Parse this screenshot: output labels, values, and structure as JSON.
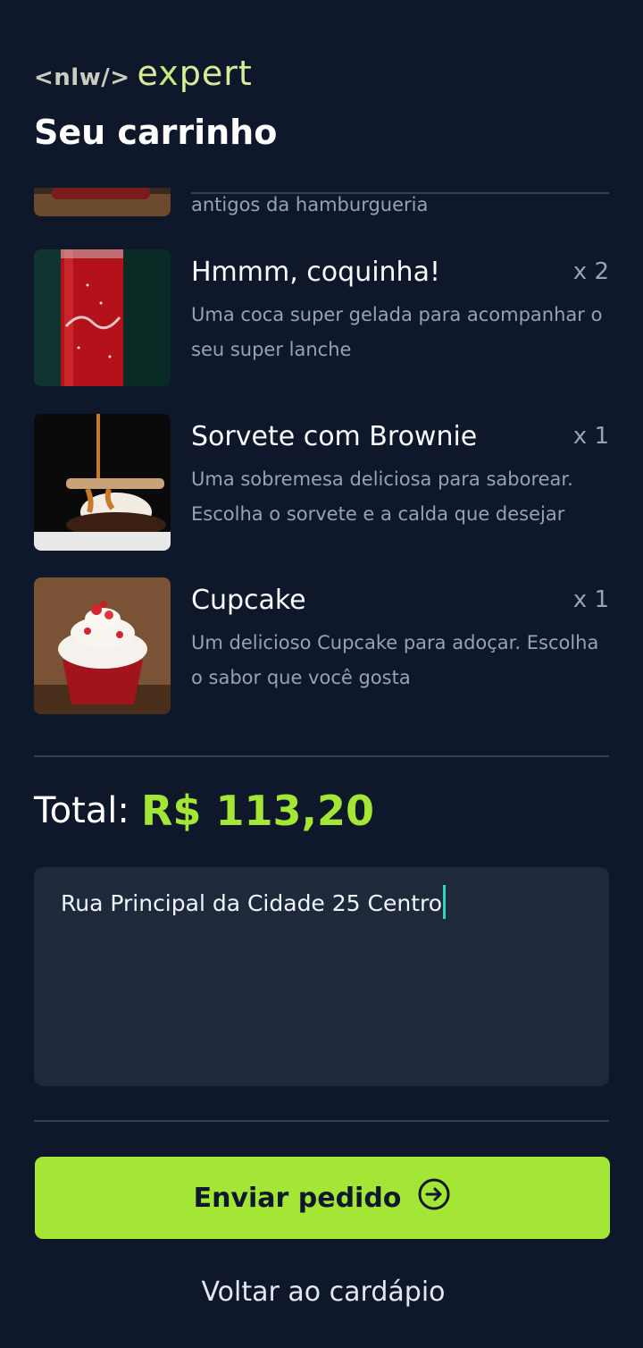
{
  "brand": {
    "nlw": "<nlw/>",
    "expert_pre": "e",
    "expert_x": "x",
    "expert_post": "pert"
  },
  "page_title": "Seu carrinho",
  "cart": {
    "partial_item_desc_tail": "antigos da hamburgueria",
    "items": [
      {
        "name": "Hmmm, coquinha!",
        "qty": "x 2",
        "desc": "Uma coca super gelada para acompanhar o seu super lanche"
      },
      {
        "name": "Sorvete com Brownie",
        "qty": "x 1",
        "desc": "Uma sobremesa deliciosa para saborear. Escolha o sorvete e a calda que desejar"
      },
      {
        "name": "Cupcake",
        "qty": "x 1",
        "desc": "Um delicioso Cupcake para adoçar. Escolha o sabor que você gosta"
      }
    ]
  },
  "total": {
    "label": "Total:",
    "value": "R$ 113,20"
  },
  "address": {
    "value": "Rua Principal da Cidade 25 Centro"
  },
  "actions": {
    "send_label": "Enviar pedido",
    "back_label": "Voltar ao cardápio"
  },
  "colors": {
    "background": "#0f172a",
    "accent": "#a3e635",
    "input_bg": "#1e293b",
    "muted": "#94a3b8"
  },
  "icons": {
    "send": "arrow-right-circle-icon"
  }
}
